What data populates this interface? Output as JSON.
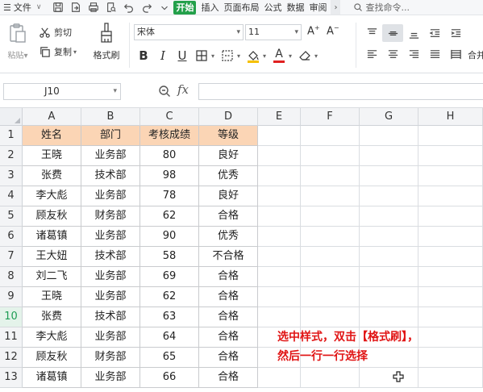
{
  "menubar": {
    "file_label": "文件",
    "tabs": [
      "开始",
      "插入",
      "页面布局",
      "公式",
      "数据",
      "审阅"
    ],
    "active_tab": "开始",
    "search_label": "查找命令..."
  },
  "ribbon": {
    "paste_label": "粘贴",
    "cut_label": "剪切",
    "copy_label": "复制",
    "format_painter_label": "格式刷",
    "font_name": "宋体",
    "font_size": "11",
    "bold": "B",
    "italic": "I",
    "underline": "U",
    "merge_label": "合并",
    "font_color": "#e02020",
    "highlight_color": "#f5c000"
  },
  "formula_bar": {
    "name_box": "J10",
    "fx": "fx",
    "formula": ""
  },
  "grid": {
    "columns": [
      "A",
      "B",
      "C",
      "D",
      "E",
      "F",
      "G",
      "H"
    ],
    "rows": [
      "1",
      "2",
      "3",
      "4",
      "5",
      "6",
      "7",
      "8",
      "9",
      "10",
      "11",
      "12",
      "13"
    ],
    "active_row": "10",
    "header_fill": "#fbd5b5",
    "table": [
      [
        "姓名",
        "部门",
        "考核成绩",
        "等级"
      ],
      [
        "王晓",
        "业务部",
        "80",
        "良好"
      ],
      [
        "张费",
        "技术部",
        "98",
        "优秀"
      ],
      [
        "李大彪",
        "业务部",
        "78",
        "良好"
      ],
      [
        "顾友秋",
        "财务部",
        "62",
        "合格"
      ],
      [
        "诸葛镇",
        "业务部",
        "90",
        "优秀"
      ],
      [
        "王大妞",
        "技术部",
        "58",
        "不合格"
      ],
      [
        "刘二飞",
        "业务部",
        "69",
        "合格"
      ],
      [
        "王晓",
        "业务部",
        "62",
        "合格"
      ],
      [
        "张费",
        "技术部",
        "63",
        "合格"
      ],
      [
        "李大彪",
        "业务部",
        "64",
        "合格"
      ],
      [
        "顾友秋",
        "财务部",
        "65",
        "合格"
      ],
      [
        "诸葛镇",
        "业务部",
        "66",
        "合格"
      ]
    ]
  },
  "annotation": {
    "line1": "选中样式，双击【格式刷】，",
    "line2": "然后一行一行选择"
  }
}
